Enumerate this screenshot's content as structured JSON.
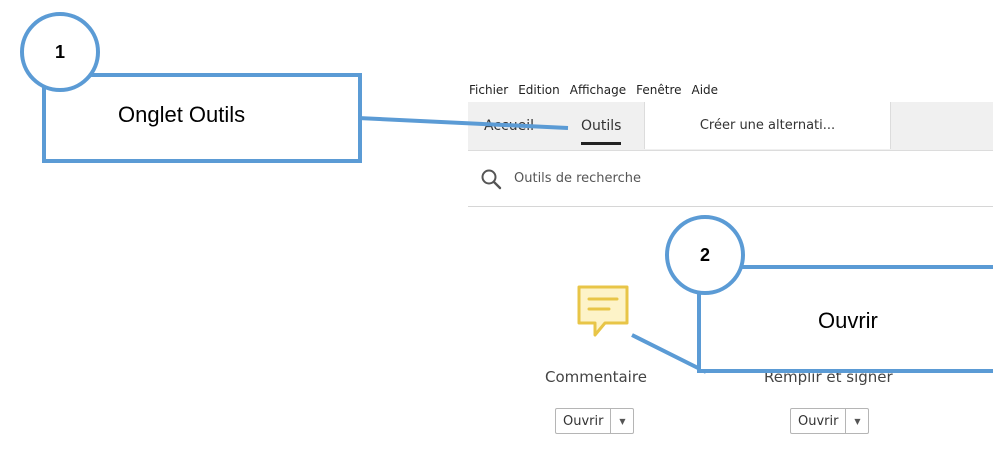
{
  "menubar": {
    "items": [
      "Fichier",
      "Edition",
      "Affichage",
      "Fenêtre",
      "Aide"
    ]
  },
  "tabs": {
    "home": "Accueil",
    "tools": "Outils",
    "document": "Créer une alternati..."
  },
  "search": {
    "placeholder": "Outils de recherche",
    "icon": "search-icon"
  },
  "tools": [
    {
      "label": "Commentaire",
      "icon": "comment-icon",
      "open_label": "Ouvrir"
    },
    {
      "label": "Remplir et signer",
      "icon": "fill-sign-icon",
      "open_label": "Ouvrir"
    }
  ],
  "callouts": [
    {
      "number": "1",
      "text": "Onglet Outils"
    },
    {
      "number": "2",
      "text": "Ouvrir"
    }
  ],
  "colors": {
    "callout_border": "#5b9bd5",
    "comment_icon": "#e8c547",
    "tab_bg": "#f0f0f0"
  }
}
